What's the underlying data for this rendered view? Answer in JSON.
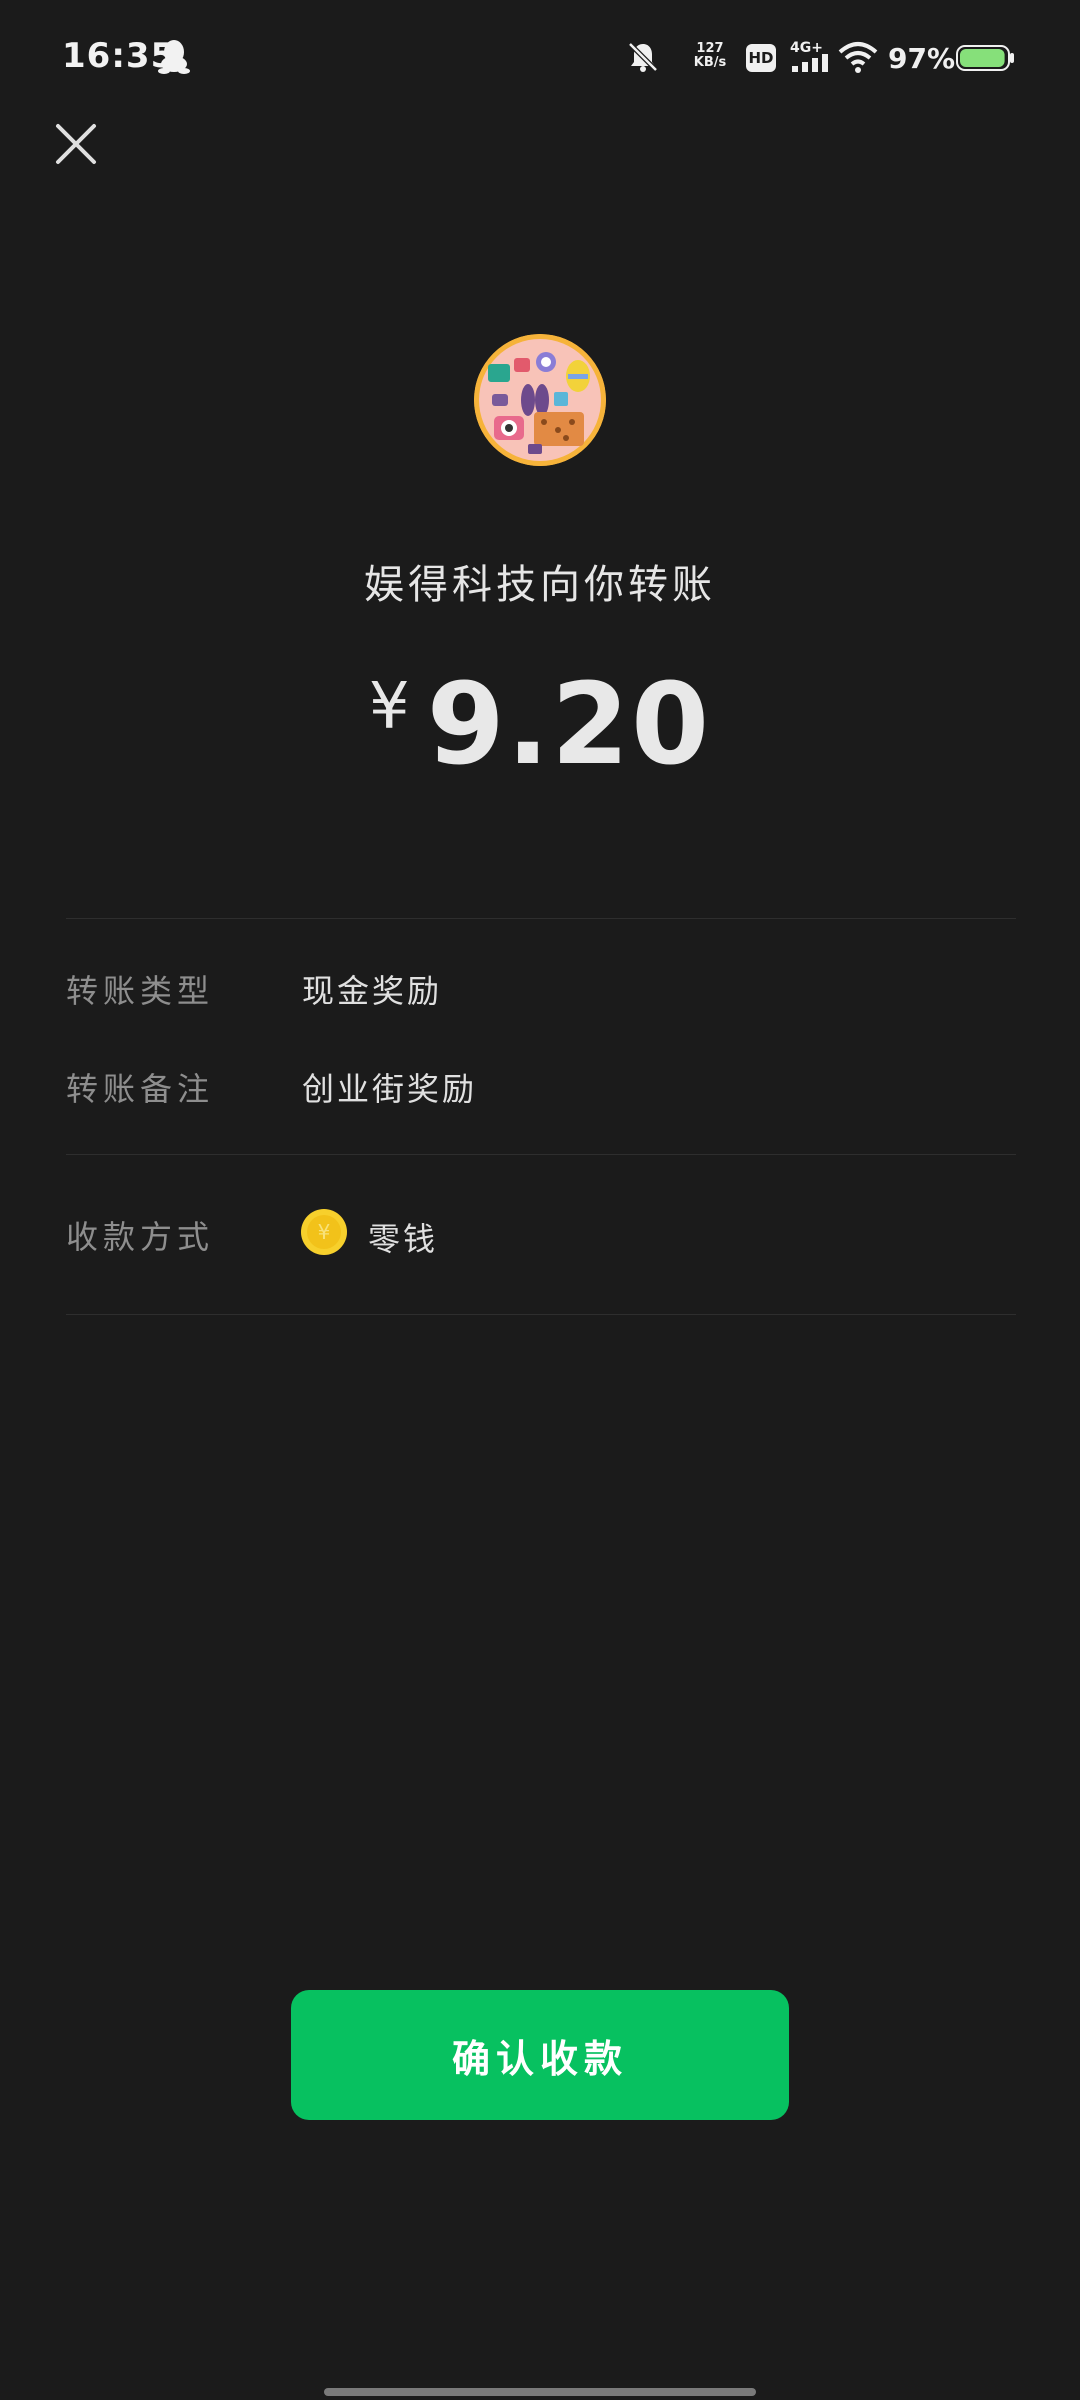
{
  "status_bar": {
    "time": "16:35",
    "net_speed_value": "127",
    "net_speed_unit": "KB/s",
    "hd_label": "HD",
    "network_label": "4G+",
    "battery_percent": "97%",
    "battery_level": 0.97
  },
  "transfer": {
    "title": "娱得科技向你转账",
    "currency": "¥",
    "amount": "9.20"
  },
  "details": {
    "type_label": "转账类型",
    "type_value": "现金奖励",
    "note_label": "转账备注",
    "note_value": "创业街奖励",
    "method_label": "收款方式",
    "method_value": "零钱",
    "coin_symbol": "¥"
  },
  "actions": {
    "confirm_label": "确认收款"
  },
  "colors": {
    "background": "#1b1b1b",
    "accent_green": "#07c160",
    "coin_yellow": "#f7d02c"
  },
  "icons": [
    "qq-icon",
    "bell-off-icon",
    "signal-icon",
    "wifi-icon",
    "battery-icon",
    "close-icon",
    "coin-icon"
  ]
}
